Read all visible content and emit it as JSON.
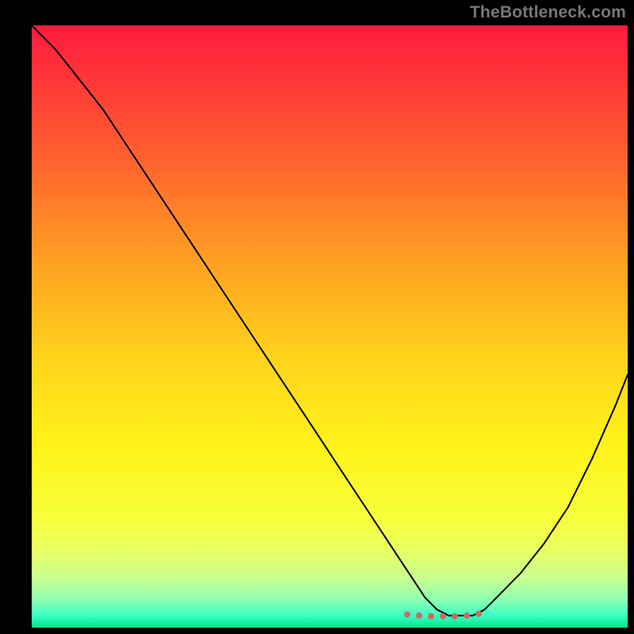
{
  "watermark": "TheBottleneck.com",
  "chart_data": {
    "type": "line",
    "title": "",
    "xlabel": "",
    "ylabel": "",
    "xlim": [
      0,
      100
    ],
    "ylim": [
      0,
      100
    ],
    "background": {
      "gradient_stops": [
        {
          "offset": 0.0,
          "color": "#ff1a3f"
        },
        {
          "offset": 0.05,
          "color": "#ff2a3c"
        },
        {
          "offset": 0.2,
          "color": "#ff5a30"
        },
        {
          "offset": 0.4,
          "color": "#ffa322"
        },
        {
          "offset": 0.55,
          "color": "#ffd21c"
        },
        {
          "offset": 0.7,
          "color": "#fff31a"
        },
        {
          "offset": 0.82,
          "color": "#f7ff3a"
        },
        {
          "offset": 0.88,
          "color": "#e4ff6a"
        },
        {
          "offset": 0.92,
          "color": "#c6ff92"
        },
        {
          "offset": 0.955,
          "color": "#8affb4"
        },
        {
          "offset": 0.98,
          "color": "#3affc4"
        },
        {
          "offset": 1.0,
          "color": "#00e58a"
        }
      ]
    },
    "border": {
      "color": "#000000",
      "inset_top": 32,
      "inset_right": 8,
      "inset_bottom": 8,
      "inset_left": 40
    },
    "series": [
      {
        "name": "bottleneck-curve",
        "color": "#000000",
        "width": 2,
        "x": [
          0,
          4,
          8,
          12,
          16,
          20,
          24,
          28,
          32,
          36,
          40,
          44,
          48,
          52,
          56,
          60,
          62,
          64,
          66,
          68,
          70,
          72,
          74,
          76,
          78,
          82,
          86,
          90,
          94,
          98,
          100
        ],
        "y": [
          100,
          96,
          91,
          86,
          80,
          74,
          68,
          62,
          56,
          50,
          44,
          38,
          32,
          26,
          20,
          14,
          11,
          8,
          5,
          3,
          2,
          2,
          2,
          3,
          5,
          9,
          14,
          20,
          28,
          37,
          42
        ]
      }
    ],
    "markers": {
      "name": "optimal-range",
      "color": "#cf6a60",
      "radius": 4,
      "x": [
        63,
        65,
        67,
        69,
        71,
        73,
        75
      ],
      "y": [
        2.2,
        2.0,
        1.9,
        1.9,
        1.9,
        2.0,
        2.3
      ]
    }
  }
}
